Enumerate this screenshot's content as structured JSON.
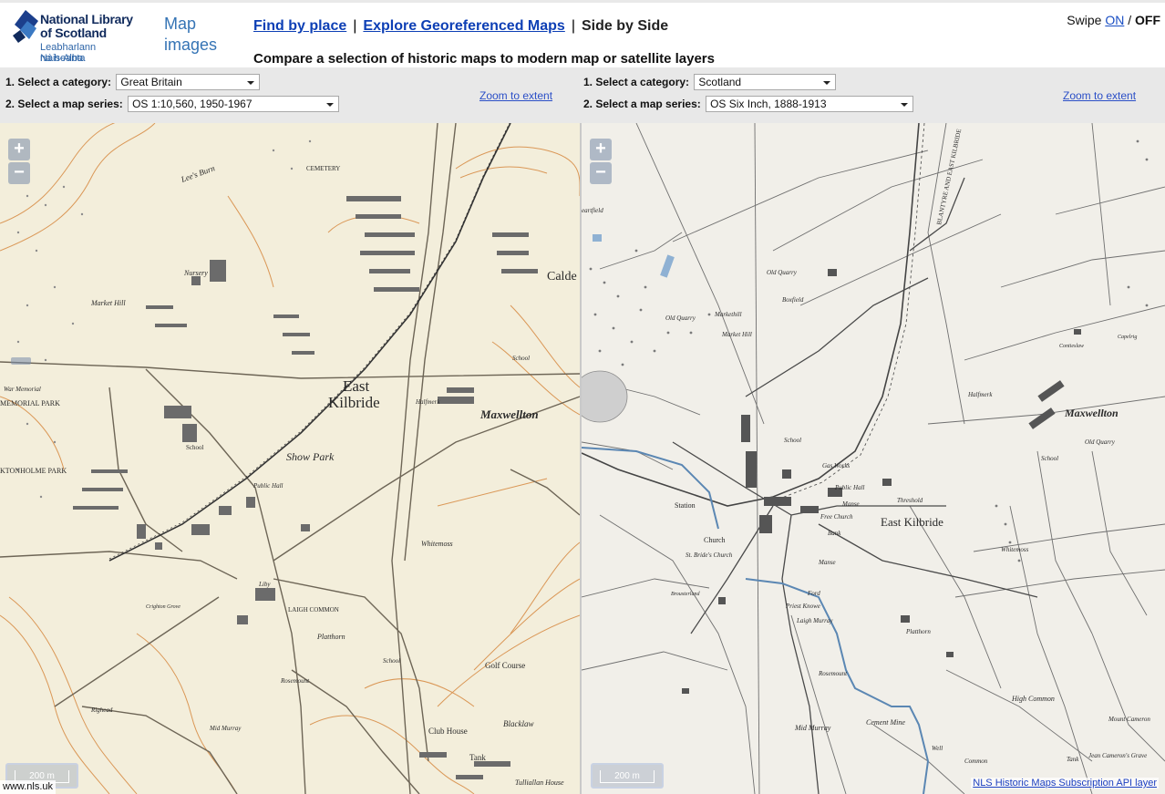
{
  "header": {
    "logo": {
      "line1": "National Library",
      "line2": "of Scotland",
      "line3": "Leabharlann Nàiseanta",
      "line4": "na h-Alba"
    },
    "section_title": "Map images",
    "nav": {
      "find_by_place": "Find by place",
      "explore_georeferenced": "Explore Georeferenced Maps",
      "separator": "|",
      "current": "Side by Side"
    },
    "subtitle": "Compare a selection of historic maps to modern map or satellite layers",
    "swipe": {
      "label": "Swipe",
      "on": "ON",
      "slash": "/",
      "off": "OFF"
    }
  },
  "left_panel": {
    "category_label": "1. Select a category:",
    "category_value": "Great Britain",
    "series_label": "2. Select a map series:",
    "series_value": "OS 1:10,560, 1950-1967",
    "zoom_to_extent": "Zoom to extent",
    "scale_text": "200 m",
    "corner_text": "www.nls.uk",
    "place_labels": {
      "east": "East",
      "kilbride": "Kilbride",
      "maxwellton": "Maxwellton",
      "calde": "Calde",
      "show_park": "Show Park",
      "whitemoss": "Whitemoss",
      "golf_course": "Golf Course",
      "club_house": "Club House",
      "blacklaw": "Blacklaw",
      "tank": "Tank",
      "tullialan_house": "Tulliallan House",
      "market_hill": "Market Hill",
      "nursery": "Nursery",
      "memorial_park": "MEMORIAL PARK",
      "school1": "School",
      "school2": "School",
      "school3": "School",
      "public_hall": "Public Hall",
      "laigh_common": "LAIGH COMMON",
      "platthorn": "Platthorn",
      "rosemount": "Rosemount",
      "mid_murray": "Mid Murray",
      "righead": "Righead",
      "lees_burn": "Lee's Burn",
      "cemetery": "CEMETERY",
      "halfmerk": "Halfmerk",
      "war_memorial": "War Memorial",
      "kittochside_park": "KTONHOLME PARK",
      "crighton_grove": "Crighton Grove",
      "library": "Liby"
    }
  },
  "right_panel": {
    "category_label": "1. Select a category:",
    "category_value": "Scotland",
    "series_label": "2. Select a map series:",
    "series_value": "OS Six Inch, 1888-1913",
    "zoom_to_extent": "Zoom to extent",
    "scale_text": "200 m",
    "api_link": "NLS Historic Maps Subscription API layer",
    "place_labels": {
      "east_kilbride": "East Kilbride",
      "maxwellton": "Maxwellton",
      "old_quarry1": "Old Quarry",
      "old_quarry2": "Old Quarry",
      "old_quarry3": "Old Quarry",
      "markethill": "Markethill",
      "market_hill": "Market Hill",
      "boxfield": "Boxfield",
      "contieslaw": "Contieslaw",
      "capelrig": "Capelrig",
      "halfmerk": "Halfmerk",
      "school1": "School",
      "school2": "School",
      "gas_works": "Gas Works",
      "public_hall": "Public Hall",
      "threshold": "Threshold",
      "manse1": "Manse",
      "free_church": "Free Church",
      "bank": "Bank",
      "manse2": "Manse",
      "station": "Station",
      "church": "Church",
      "st_brides": "St. Bride's Church",
      "brouster": "Brousterland",
      "ford": "Ford",
      "priest_knowe": "Priest Knowe",
      "laigh_murray": "Laigh Murray",
      "whitemoss": "Whitemoss",
      "platthorn": "Platthorn",
      "rosemount": "Rosemount",
      "mid_murray": "Mid Murray",
      "cement_mine": "Cement Mine",
      "high_common": "High Common",
      "mount_cameron": "Mount Cameron",
      "jean_grave": "Jean Cameron's Grave",
      "tank": "Tank",
      "common": "Common",
      "well": "Well",
      "blantyre": "BLANTYRE AND EAST KILBRIDE",
      "heatfield": "eartfield"
    }
  },
  "colors": {
    "left_map_bg": "#f3eedb",
    "right_map_bg": "#f1efe9",
    "contour": "#d6883f",
    "ink": "#333333",
    "link": "#0d3fb5",
    "section_title": "#3574b5",
    "controls_bg": "#e8e8e8",
    "stream": "#5b87b3"
  },
  "icons": {
    "zoom_in": "plus-icon",
    "zoom_out": "minus-icon",
    "logo": "nls-logo-icon"
  }
}
